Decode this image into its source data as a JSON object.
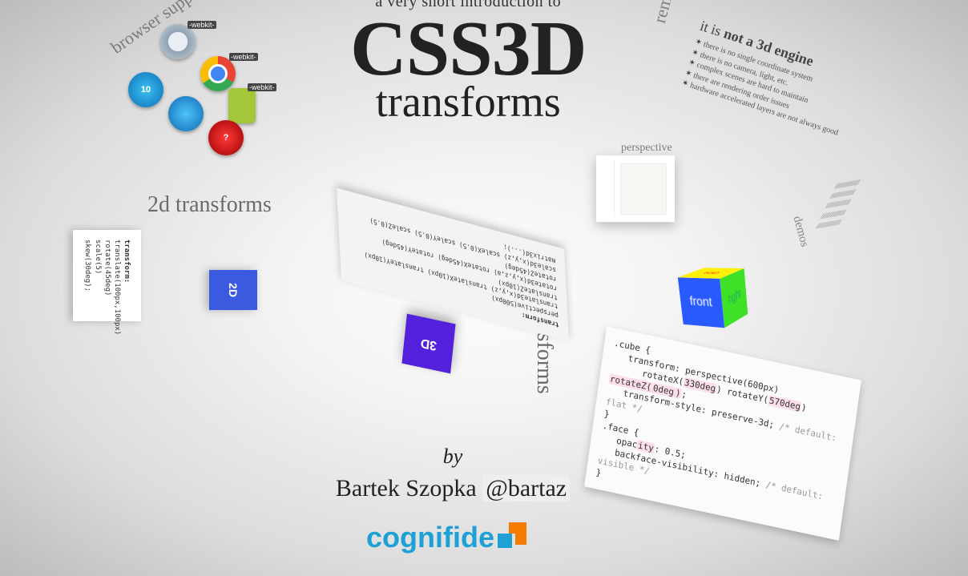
{
  "title": {
    "intro": "a very short introduction to",
    "main": "CSS3D",
    "sub": "transforms"
  },
  "byline": {
    "by": "by",
    "author": "Bartek Szopka ",
    "handle": "@bartaz"
  },
  "browser_support": {
    "label": "browser support",
    "ie_version": "10",
    "opera_mark": "?",
    "prefix": {
      "webkit": "-webkit-"
    }
  },
  "two_d": {
    "label": "2d transforms",
    "tile": "2D",
    "code": [
      "transform:",
      "  translate(100px,100px)",
      "  rotate(45deg)",
      "  scale(5)",
      "  skew(30deg);"
    ]
  },
  "three_d": {
    "label": "3d transforms",
    "tile": "3D",
    "code": [
      "transform:",
      "  perspective(500px)",
      "  translate3d(x,y,z) translateX(10px) translateY(10px) translateZ(10px)",
      "  rotate3d(x,y,z,a) rotateX(45deg) rotateY(45deg) rotateZ(45deg)",
      "  scale3d(x,y,z) scaleX(0.5) scaleY(0.5) scaleZ(0.5)",
      "  matrix3d(...);"
    ]
  },
  "remember": {
    "label": "remember",
    "head_a": "it is ",
    "head_b": "not a 3d engine",
    "items": [
      "there is no single coordinate system",
      "there is no camera, light, etc.",
      "complex scenes are hard to maintain",
      "there are rendering order issues",
      "hardware accelerated layers are not always good"
    ]
  },
  "perspective": {
    "label": "perspective"
  },
  "demos": {
    "label": "demos",
    "lines": "///////////////\n///////////////\n///////////////\n///////////////\n///////////////"
  },
  "cube": {
    "faces": {
      "front": "front",
      "right": "right",
      "top": "top"
    }
  },
  "cube_code": {
    "0": ".cube {",
    "1": "transform: perspective(600px)",
    "3": "transform-style: preserve-3d;",
    "3c": "/* default: flat */",
    "4": "}",
    "5": ".face {",
    "7": "backface-visibility: hidden;",
    "7c": "/* default: visible */",
    "8": "}"
  },
  "cube_code_hl": {
    "rx": "330deg",
    "ry": "570deg",
    "rz": "0deg",
    "op": "ity"
  },
  "logo": {
    "text": "cognifide"
  }
}
